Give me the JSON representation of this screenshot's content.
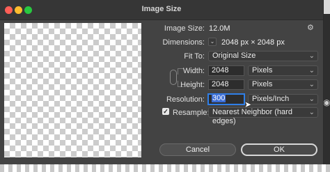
{
  "window": {
    "title": "Image Size"
  },
  "image_size": {
    "label": "Image Size:",
    "value": "12.0M"
  },
  "dimensions": {
    "label": "Dimensions:",
    "value": "2048 px × 2048 px"
  },
  "fit_to": {
    "label": "Fit To:",
    "value": "Original Size"
  },
  "width": {
    "label": "Width:",
    "value": "2048",
    "unit": "Pixels"
  },
  "height": {
    "label": "Height:",
    "value": "2048",
    "unit": "Pixels"
  },
  "resolution": {
    "label": "Resolution:",
    "value": "300",
    "unit": "Pixels/Inch"
  },
  "resample": {
    "label": "Resample:",
    "checked": true,
    "method": "Nearest Neighbor (hard edges)"
  },
  "buttons": {
    "cancel": "Cancel",
    "ok": "OK"
  },
  "icons": {
    "gear": "gear-icon",
    "chevron": "chevron-down-icon",
    "link": "link-icon",
    "cursor": "mouse-pointer-icon"
  },
  "colors": {
    "close": "#ff5f57",
    "minimize": "#febc2e",
    "zoom": "#28c840",
    "focus_ring": "#2f7fe8"
  }
}
